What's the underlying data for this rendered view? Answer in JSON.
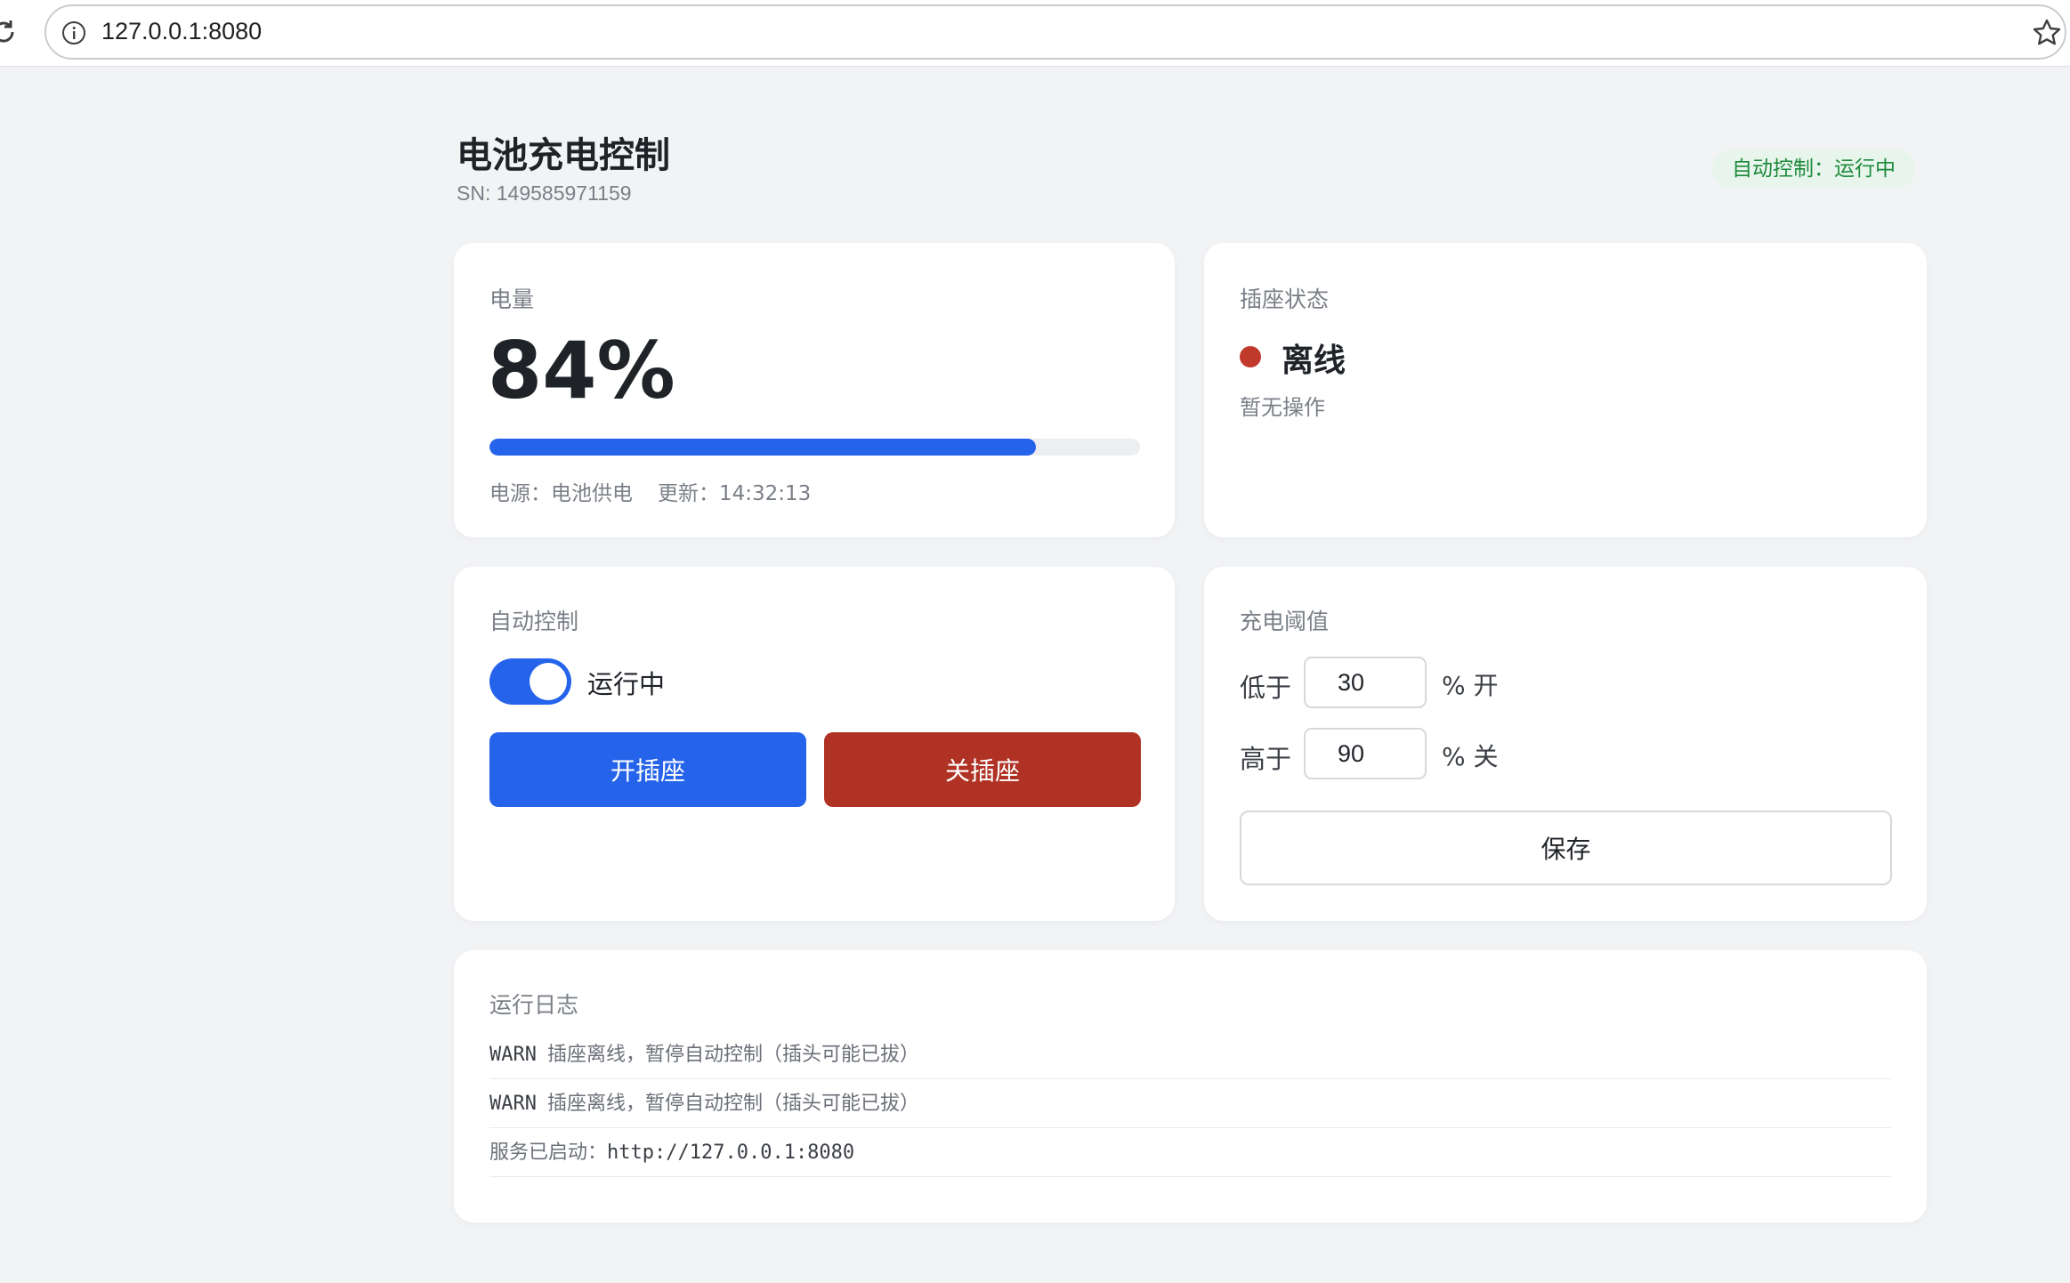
{
  "browser": {
    "url": "127.0.0.1:8080"
  },
  "header": {
    "title": "电池充电控制",
    "sn": "SN: 149585971159",
    "auto_status": "自动控制：运行中"
  },
  "battery": {
    "label": "电量",
    "value": "84%",
    "level_percent": 84,
    "power_source": "电源：电池供电",
    "updated": "更新：14:32:13"
  },
  "socket": {
    "label": "插座状态",
    "status": "离线",
    "status_color": "#c0392b",
    "sub": "暂无操作"
  },
  "auto_control": {
    "label": "自动控制",
    "toggle_on": true,
    "toggle_label": "运行中",
    "on_button": "开插座",
    "off_button": "关插座"
  },
  "threshold": {
    "label": "充电阈值",
    "low_label": "低于",
    "low_value": "30",
    "low_unit": "% 开",
    "high_label": "高于",
    "high_value": "90",
    "high_unit": "% 关",
    "save_button": "保存"
  },
  "log": {
    "label": "运行日志",
    "entries": [
      {
        "level": "WARN",
        "message": "插座离线，暂停自动控制（插头可能已拔）"
      },
      {
        "level": "WARN",
        "message": "插座离线，暂停自动控制（插头可能已拔）"
      },
      {
        "prefix": "服务已启动：",
        "url": "http://127.0.0.1:8080"
      }
    ]
  },
  "colors": {
    "accent": "#2563eb",
    "danger": "#b03225",
    "success_text": "#1e8a3c",
    "background": "#f2f3f5"
  }
}
